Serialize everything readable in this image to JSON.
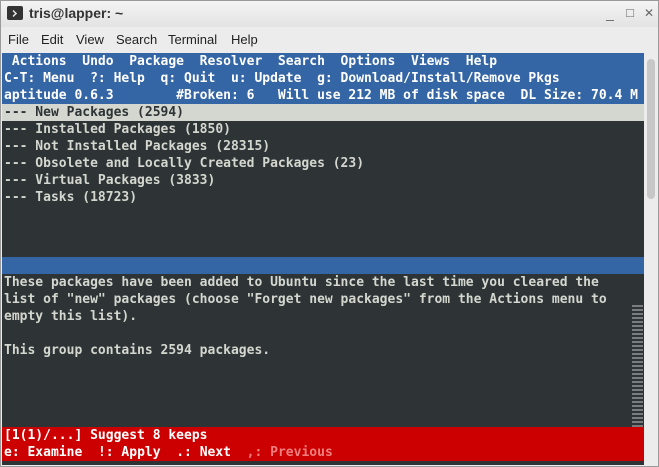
{
  "window": {
    "title": "tris@lapper: ~",
    "minimize": "_",
    "maximize": "□",
    "close": "✕"
  },
  "menubar": [
    "File",
    "Edit",
    "View",
    "Search",
    "Terminal",
    "Help"
  ],
  "terminal": {
    "menu_line": " Actions  Undo  Package  Resolver  Search  Options  Views  Help",
    "keys_line": "C-T: Menu  ?: Help  q: Quit  u: Update  g: Download/Install/Remove Pkgs",
    "status_line": "aptitude 0.6.3        #Broken: 6   Will use 212 MB of disk space  DL Size: 70.4 M",
    "tree": [
      "--- New Packages (2594)",
      "--- Installed Packages (1850)",
      "--- Not Installed Packages (28315)",
      "--- Obsolete and Locally Created Packages (23)",
      "--- Virtual Packages (3833)",
      "--- Tasks (18723)"
    ],
    "description": [
      "These packages have been added to Ubuntu since the last time you cleared the",
      "list of \"new\" packages (choose \"Forget new packages\" from the Actions menu to",
      "empty this list).",
      "",
      "This group contains 2594 packages."
    ],
    "suggest_line": "[1(1)/...] Suggest 8 keeps",
    "nav_examine": "e: Examine",
    "nav_apply": "!: Apply",
    "nav_next": ".: Next",
    "nav_previous": ",: Previous"
  }
}
